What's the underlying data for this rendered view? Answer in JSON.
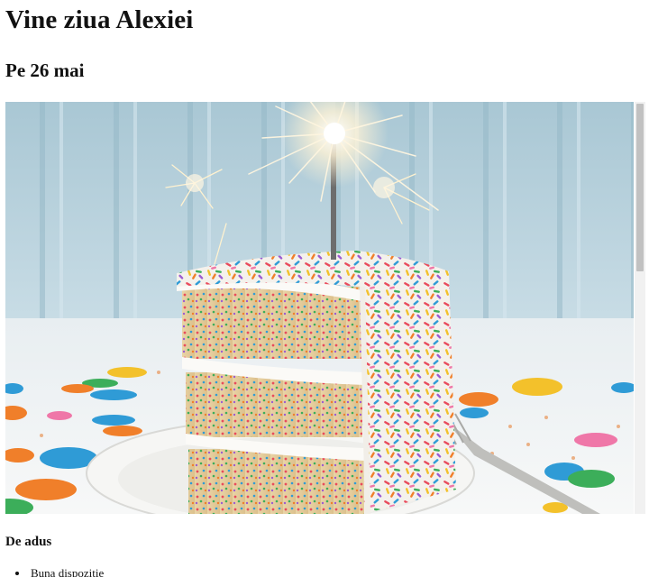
{
  "page": {
    "title": "Vine ziua Alexiei",
    "subtitle": "Pe 26 mai"
  },
  "photo": {
    "alt": "Felie de tort cu artificii"
  },
  "bring_section": {
    "heading": "De adus",
    "items": [
      {
        "label": "Buna dispozitie"
      }
    ]
  }
}
